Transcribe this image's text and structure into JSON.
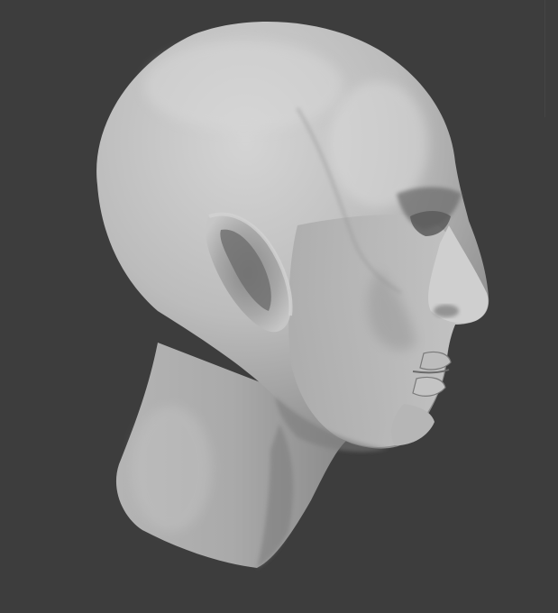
{
  "viewport": {
    "background_color": "#3d3d3d",
    "model": {
      "kind": "sculpted-head-mesh",
      "shading": "matcap-gray",
      "base_color": "#bdbdbd",
      "highlight_color": "#d8d8d8",
      "shadow_color": "#6a6a6a",
      "facing": "right"
    }
  }
}
